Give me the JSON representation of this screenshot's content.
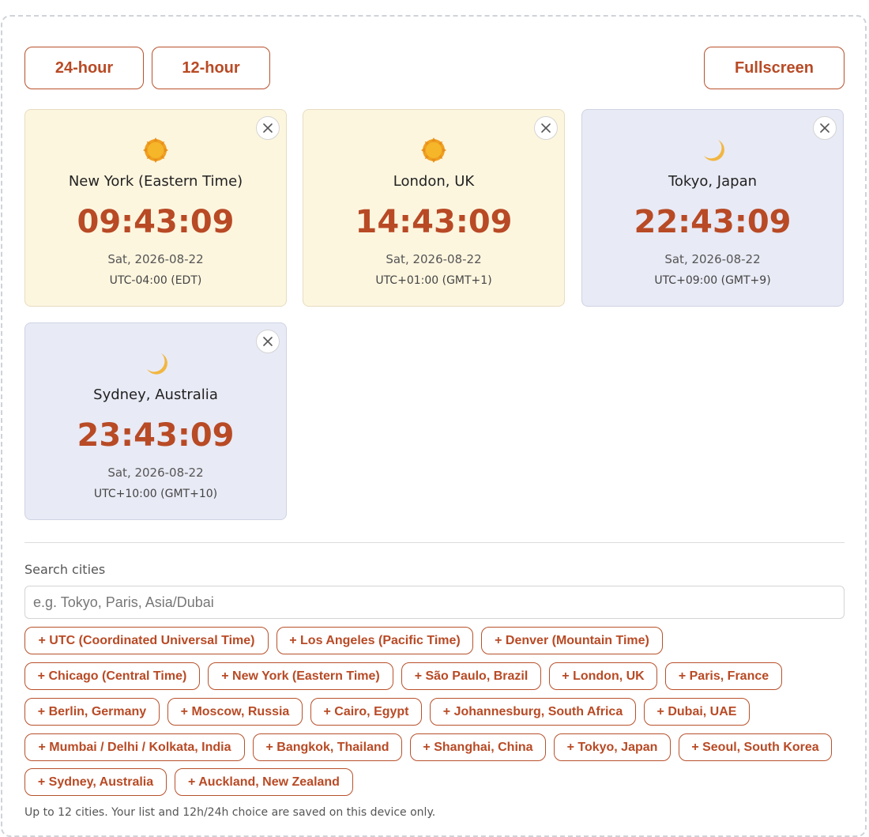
{
  "toolbar": {
    "btn_24": "24-hour",
    "btn_12": "12-hour",
    "btn_fullscreen": "Fullscreen"
  },
  "clocks": [
    {
      "city": "New York (Eastern Time)",
      "time": "09:43:09",
      "date": "Sat, 2026-08-22",
      "tz": "UTC-04:00 (EDT)",
      "phase": "sun-icon"
    },
    {
      "city": "London, UK",
      "time": "14:43:09",
      "date": "Sat, 2026-08-22",
      "tz": "UTC+01:00 (GMT+1)",
      "phase": "sun-icon"
    },
    {
      "city": "Tokyo, Japan",
      "time": "22:43:09",
      "date": "Sat, 2026-08-22",
      "tz": "UTC+09:00 (GMT+9)",
      "phase": "moon-icon"
    },
    {
      "city": "Sydney, Australia",
      "time": "23:43:09",
      "date": "Sat, 2026-08-22",
      "tz": "UTC+10:00 (GMT+10)",
      "phase": "moon-icon"
    }
  ],
  "search": {
    "label": "Search cities",
    "placeholder": "e.g. Tokyo, Paris, Asia/Dubai"
  },
  "suggestions": [
    "+ UTC (Coordinated Universal Time)",
    "+ Los Angeles (Pacific Time)",
    "+ Denver (Mountain Time)",
    "+ Chicago (Central Time)",
    "+ New York (Eastern Time)",
    "+ São Paulo, Brazil",
    "+ London, UK",
    "+ Paris, France",
    "+ Berlin, Germany",
    "+ Moscow, Russia",
    "+ Cairo, Egypt",
    "+ Johannesburg, South Africa",
    "+ Dubai, UAE",
    "+ Mumbai / Delhi / Kolkata, India",
    "+ Bangkok, Thailand",
    "+ Shanghai, China",
    "+ Tokyo, Japan",
    "+ Seoul, South Korea",
    "+ Sydney, Australia",
    "+ Auckland, New Zealand"
  ],
  "footnote": "Up to 12 cities. Your list and 12h/24h choice are saved on this device only.",
  "colors": {
    "accent": "#b84a25",
    "day_card": "#fdf6df",
    "night_card": "#e8eaf5"
  }
}
